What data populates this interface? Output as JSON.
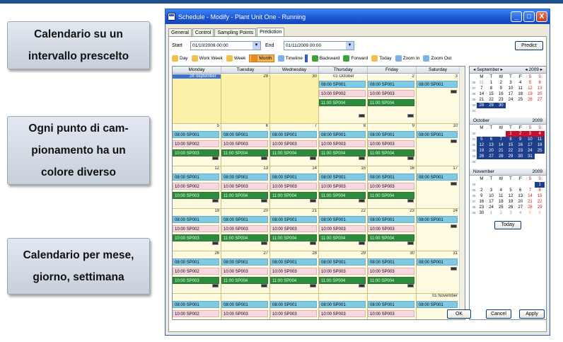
{
  "notes": [
    "Calendario su un\nintervallo prescelto",
    "Ogni punto di cam-\npionamento ha un\ncolore diverso",
    "Calendario per mese,\ngiorno, settimana"
  ],
  "window": {
    "title": "Schedule - Modify - Plant Unit One - Running",
    "controls": [
      "_",
      "□",
      "X"
    ]
  },
  "tabs": [
    "General",
    "Control",
    "Sampling Points",
    "Prediction"
  ],
  "range": {
    "start_label": "Start",
    "start_value": "01/10/2009 00:00",
    "end_label": "End",
    "end_value": "01/11/2009 00:00",
    "predict": "Predict"
  },
  "toolbar": [
    {
      "label": "Day",
      "color": "#f3c04f"
    },
    {
      "label": "Work Week",
      "color": "#f3c04f"
    },
    {
      "label": "Week",
      "color": "#f3c04f"
    },
    {
      "label": "Month",
      "color": "#e88a1e",
      "active": true
    },
    {
      "label": "Timeline",
      "color": "#7db2e8"
    },
    {
      "label": "Backward",
      "color": "#3aa43a"
    },
    {
      "label": "Forward",
      "color": "#3aa43a"
    },
    {
      "label": "Today",
      "color": "#f3c04f"
    },
    {
      "label": "Zoom In",
      "color": "#7db2e8"
    },
    {
      "label": "Zoom Out",
      "color": "#7db2e8"
    }
  ],
  "days": [
    "Monday",
    "Tuesday",
    "Wednesday",
    "Thursday",
    "Friday",
    "Saturday"
  ],
  "weeks": [
    [
      {
        "n": "28 September",
        "full": true,
        "out": true
      },
      {
        "n": "29",
        "out": true
      },
      {
        "n": "30",
        "out": true
      },
      {
        "n": "01 October",
        "ev": [
          1,
          2,
          3
        ]
      },
      {
        "n": "2",
        "ev": [
          1,
          2,
          3
        ]
      },
      {
        "n": "3",
        "ev": [
          1
        ]
      }
    ],
    [
      {
        "n": "5",
        "ev": [
          1,
          2,
          3
        ]
      },
      {
        "n": "6",
        "ev": [
          1,
          2,
          3
        ]
      },
      {
        "n": "7",
        "ev": [
          1,
          2,
          3
        ]
      },
      {
        "n": "8",
        "ev": [
          1,
          2,
          3
        ]
      },
      {
        "n": "9",
        "ev": [
          1,
          2,
          3
        ]
      },
      {
        "n": "10",
        "ev": [
          1
        ]
      }
    ],
    [
      {
        "n": "12",
        "ev": [
          1,
          2,
          3
        ]
      },
      {
        "n": "13",
        "ev": [
          1,
          2,
          3
        ]
      },
      {
        "n": "14",
        "ev": [
          1,
          2,
          3
        ]
      },
      {
        "n": "15",
        "ev": [
          1,
          2,
          3
        ]
      },
      {
        "n": "16",
        "ev": [
          1,
          2,
          3
        ]
      },
      {
        "n": "17",
        "ev": [
          1
        ]
      }
    ],
    [
      {
        "n": "19",
        "ev": [
          1,
          2,
          3
        ]
      },
      {
        "n": "20",
        "ev": [
          1,
          2,
          3
        ]
      },
      {
        "n": "21",
        "ev": [
          1,
          2,
          3
        ]
      },
      {
        "n": "22",
        "ev": [
          1,
          2,
          3
        ]
      },
      {
        "n": "23",
        "ev": [
          1,
          2,
          3
        ]
      },
      {
        "n": "24",
        "ev": [
          1
        ]
      }
    ],
    [
      {
        "n": "26",
        "ev": [
          1,
          2,
          3
        ]
      },
      {
        "n": "27",
        "ev": [
          1,
          2,
          3
        ]
      },
      {
        "n": "28",
        "ev": [
          1,
          2,
          3
        ]
      },
      {
        "n": "29",
        "ev": [
          1,
          2,
          3
        ]
      },
      {
        "n": "30",
        "ev": [
          1,
          2,
          3
        ]
      },
      {
        "n": "31",
        "ev": [
          1
        ]
      }
    ],
    [
      {
        "n": "",
        "ev": [
          1,
          2,
          3
        ]
      },
      {
        "n": "",
        "ev": [
          1,
          2,
          3
        ]
      },
      {
        "n": "",
        "ev": [
          1,
          2,
          3
        ]
      },
      {
        "n": "",
        "ev": [
          1,
          2,
          3
        ]
      },
      {
        "n": "",
        "ev": [
          1,
          2,
          3
        ]
      },
      {
        "n": "01 November",
        "ev": [
          1
        ]
      }
    ]
  ],
  "events": {
    "1": "08:00 SP001",
    "2": "10:00 SP002",
    "3": "11:00 SP004",
    "2b": "10:00 SP003",
    "3b": "10:00 SP003"
  },
  "mini": [
    {
      "month": "September",
      "year": "2009",
      "nav": true,
      "rows": [
        [
          "36",
          "31",
          "1",
          "2",
          "3",
          "4",
          "5",
          "6"
        ],
        [
          "37",
          "7",
          "8",
          "9",
          "10",
          "11",
          "12",
          "13"
        ],
        [
          "38",
          "14",
          "15",
          "16",
          "17",
          "18",
          "19",
          "20"
        ],
        [
          "39",
          "21",
          "22",
          "23",
          "24",
          "25",
          "26",
          "27"
        ],
        [
          "40",
          "28",
          "29",
          "30",
          "",
          "",
          "",
          ""
        ],
        [
          "41",
          "",
          "",
          "",
          "",
          "",
          "",
          ""
        ]
      ]
    },
    {
      "month": "October",
      "year": "2009",
      "rows": [
        [
          "40",
          "",
          "",
          "",
          "1",
          "2",
          "3",
          "4"
        ],
        [
          "41",
          "5",
          "6",
          "7",
          "8",
          "9",
          "10",
          "11"
        ],
        [
          "42",
          "12",
          "13",
          "14",
          "15",
          "16",
          "17",
          "18"
        ],
        [
          "43",
          "19",
          "20",
          "21",
          "22",
          "23",
          "24",
          "25"
        ],
        [
          "44",
          "26",
          "27",
          "28",
          "29",
          "30",
          "31",
          ""
        ],
        [
          "45",
          "",
          "",
          "",
          "",
          "",
          "",
          ""
        ]
      ]
    },
    {
      "month": "November",
      "year": "2009",
      "rows": [
        [
          "44",
          "",
          "",
          "",
          "",
          "",
          "",
          "1"
        ],
        [
          "45",
          "2",
          "3",
          "4",
          "5",
          "6",
          "7",
          "8"
        ],
        [
          "46",
          "9",
          "10",
          "11",
          "12",
          "13",
          "14",
          "15"
        ],
        [
          "47",
          "16",
          "17",
          "18",
          "19",
          "20",
          "21",
          "22"
        ],
        [
          "48",
          "23",
          "24",
          "25",
          "26",
          "27",
          "28",
          "29"
        ],
        [
          "49",
          "30",
          "1",
          "2",
          "3",
          "4",
          "5",
          "6"
        ]
      ]
    }
  ],
  "weekday_letters": [
    "M",
    "T",
    "W",
    "T",
    "F",
    "S",
    "S"
  ],
  "today": "Today",
  "buttons": {
    "ok": "OK",
    "cancel": "Cancel",
    "apply": "Apply"
  }
}
